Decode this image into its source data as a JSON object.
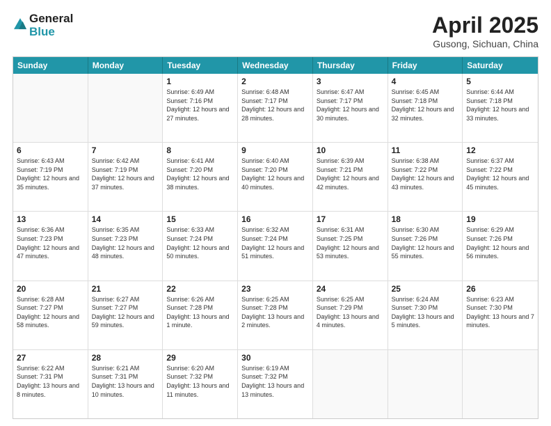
{
  "header": {
    "logo_line1": "General",
    "logo_line2": "Blue",
    "month_title": "April 2025",
    "location": "Gusong, Sichuan, China"
  },
  "days_of_week": [
    "Sunday",
    "Monday",
    "Tuesday",
    "Wednesday",
    "Thursday",
    "Friday",
    "Saturday"
  ],
  "weeks": [
    [
      {
        "day": "",
        "empty": true
      },
      {
        "day": "",
        "empty": true
      },
      {
        "day": "1",
        "sunrise": "6:49 AM",
        "sunset": "7:16 PM",
        "daylight": "12 hours and 27 minutes."
      },
      {
        "day": "2",
        "sunrise": "6:48 AM",
        "sunset": "7:17 PM",
        "daylight": "12 hours and 28 minutes."
      },
      {
        "day": "3",
        "sunrise": "6:47 AM",
        "sunset": "7:17 PM",
        "daylight": "12 hours and 30 minutes."
      },
      {
        "day": "4",
        "sunrise": "6:45 AM",
        "sunset": "7:18 PM",
        "daylight": "12 hours and 32 minutes."
      },
      {
        "day": "5",
        "sunrise": "6:44 AM",
        "sunset": "7:18 PM",
        "daylight": "12 hours and 33 minutes."
      }
    ],
    [
      {
        "day": "6",
        "sunrise": "6:43 AM",
        "sunset": "7:19 PM",
        "daylight": "12 hours and 35 minutes."
      },
      {
        "day": "7",
        "sunrise": "6:42 AM",
        "sunset": "7:19 PM",
        "daylight": "12 hours and 37 minutes."
      },
      {
        "day": "8",
        "sunrise": "6:41 AM",
        "sunset": "7:20 PM",
        "daylight": "12 hours and 38 minutes."
      },
      {
        "day": "9",
        "sunrise": "6:40 AM",
        "sunset": "7:20 PM",
        "daylight": "12 hours and 40 minutes."
      },
      {
        "day": "10",
        "sunrise": "6:39 AM",
        "sunset": "7:21 PM",
        "daylight": "12 hours and 42 minutes."
      },
      {
        "day": "11",
        "sunrise": "6:38 AM",
        "sunset": "7:22 PM",
        "daylight": "12 hours and 43 minutes."
      },
      {
        "day": "12",
        "sunrise": "6:37 AM",
        "sunset": "7:22 PM",
        "daylight": "12 hours and 45 minutes."
      }
    ],
    [
      {
        "day": "13",
        "sunrise": "6:36 AM",
        "sunset": "7:23 PM",
        "daylight": "12 hours and 47 minutes."
      },
      {
        "day": "14",
        "sunrise": "6:35 AM",
        "sunset": "7:23 PM",
        "daylight": "12 hours and 48 minutes."
      },
      {
        "day": "15",
        "sunrise": "6:33 AM",
        "sunset": "7:24 PM",
        "daylight": "12 hours and 50 minutes."
      },
      {
        "day": "16",
        "sunrise": "6:32 AM",
        "sunset": "7:24 PM",
        "daylight": "12 hours and 51 minutes."
      },
      {
        "day": "17",
        "sunrise": "6:31 AM",
        "sunset": "7:25 PM",
        "daylight": "12 hours and 53 minutes."
      },
      {
        "day": "18",
        "sunrise": "6:30 AM",
        "sunset": "7:26 PM",
        "daylight": "12 hours and 55 minutes."
      },
      {
        "day": "19",
        "sunrise": "6:29 AM",
        "sunset": "7:26 PM",
        "daylight": "12 hours and 56 minutes."
      }
    ],
    [
      {
        "day": "20",
        "sunrise": "6:28 AM",
        "sunset": "7:27 PM",
        "daylight": "12 hours and 58 minutes."
      },
      {
        "day": "21",
        "sunrise": "6:27 AM",
        "sunset": "7:27 PM",
        "daylight": "12 hours and 59 minutes."
      },
      {
        "day": "22",
        "sunrise": "6:26 AM",
        "sunset": "7:28 PM",
        "daylight": "13 hours and 1 minute."
      },
      {
        "day": "23",
        "sunrise": "6:25 AM",
        "sunset": "7:28 PM",
        "daylight": "13 hours and 2 minutes."
      },
      {
        "day": "24",
        "sunrise": "6:25 AM",
        "sunset": "7:29 PM",
        "daylight": "13 hours and 4 minutes."
      },
      {
        "day": "25",
        "sunrise": "6:24 AM",
        "sunset": "7:30 PM",
        "daylight": "13 hours and 5 minutes."
      },
      {
        "day": "26",
        "sunrise": "6:23 AM",
        "sunset": "7:30 PM",
        "daylight": "13 hours and 7 minutes."
      }
    ],
    [
      {
        "day": "27",
        "sunrise": "6:22 AM",
        "sunset": "7:31 PM",
        "daylight": "13 hours and 8 minutes."
      },
      {
        "day": "28",
        "sunrise": "6:21 AM",
        "sunset": "7:31 PM",
        "daylight": "13 hours and 10 minutes."
      },
      {
        "day": "29",
        "sunrise": "6:20 AM",
        "sunset": "7:32 PM",
        "daylight": "13 hours and 11 minutes."
      },
      {
        "day": "30",
        "sunrise": "6:19 AM",
        "sunset": "7:32 PM",
        "daylight": "13 hours and 13 minutes."
      },
      {
        "day": "",
        "empty": true
      },
      {
        "day": "",
        "empty": true
      },
      {
        "day": "",
        "empty": true
      }
    ]
  ],
  "labels": {
    "sunrise_prefix": "Sunrise: ",
    "sunset_prefix": "Sunset: ",
    "daylight_prefix": "Daylight: "
  }
}
